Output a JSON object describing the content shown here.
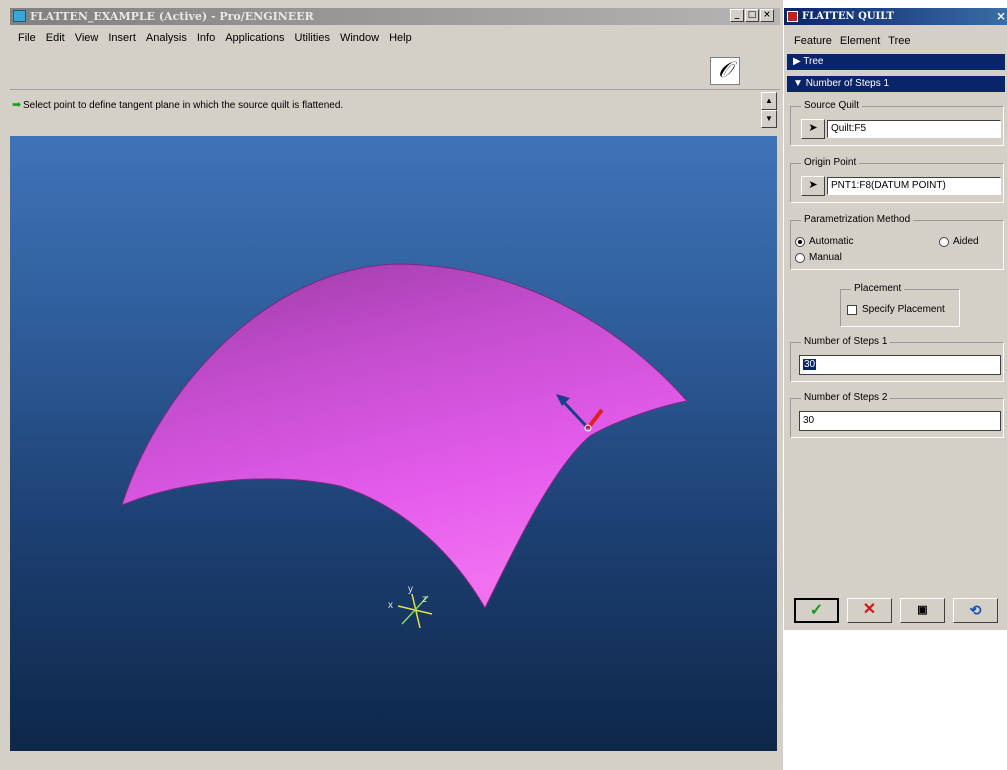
{
  "window": {
    "title": "FLATTEN_EXAMPLE (Active) - Pro/ENGINEER",
    "buttons": [
      "_",
      "□",
      "×"
    ]
  },
  "menu": [
    "File",
    "Edit",
    "View",
    "Insert",
    "Analysis",
    "Info",
    "Applications",
    "Utilities",
    "Window",
    "Help"
  ],
  "message": {
    "icon": "arrow-right-icon",
    "text": "Select point to define tangent plane in which the source quilt is flattened."
  },
  "viewport": {
    "axis_labels": {
      "x": "x",
      "y": "y",
      "z": "z"
    },
    "colors": {
      "surface": "#e055e8",
      "bg_top": "#3f73b8",
      "bg_bottom": "#0e2749"
    }
  },
  "panel": {
    "title": "FLATTEN QUILT",
    "menu": [
      "Feature",
      "Element",
      "Tree"
    ],
    "tree_label": "Tree",
    "steps_header": "Number of Steps 1",
    "source_quilt": {
      "label": "Source Quilt",
      "value": "Quilt:F5"
    },
    "origin_point": {
      "label": "Origin Point",
      "value": "PNT1:F8(DATUM POINT)"
    },
    "param_method": {
      "label": "Parametrization Method",
      "options": [
        "Automatic",
        "Aided",
        "Manual"
      ],
      "selected": "Automatic"
    },
    "placement": {
      "label": "Placement",
      "checkbox_label": "Specify Placement",
      "checked": false
    },
    "steps1": {
      "label": "Number of Steps 1",
      "value": "30"
    },
    "steps2": {
      "label": "Number of Steps 2",
      "value": "30"
    },
    "actions": [
      "OK",
      "Cancel",
      "Preview",
      "Redo"
    ]
  }
}
